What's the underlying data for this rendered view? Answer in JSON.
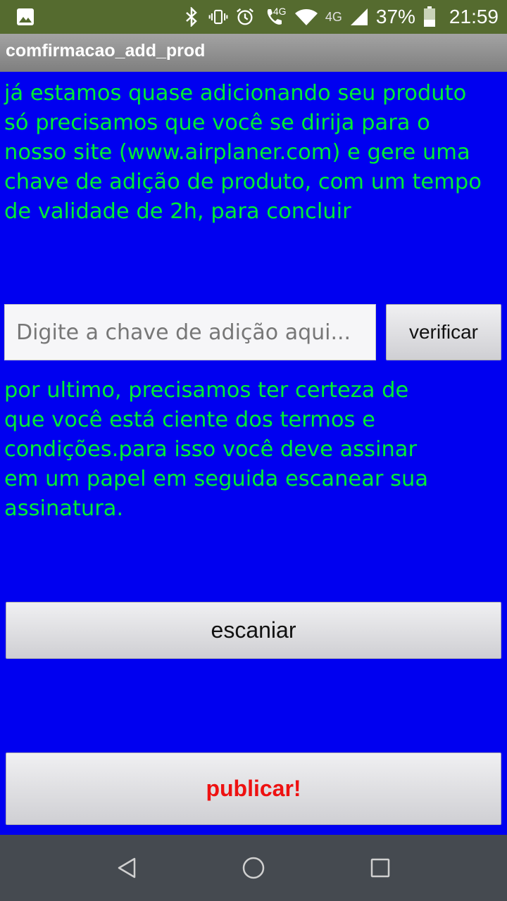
{
  "status_bar": {
    "network_label": "4G",
    "signal_label": "4G",
    "battery_percent": "37%",
    "time": "21:59",
    "icons": [
      "image-icon",
      "bluetooth-icon",
      "vibrate-icon",
      "alarm-icon",
      "volte-call-icon",
      "wifi-icon",
      "signal-icon",
      "battery-icon"
    ]
  },
  "action_bar": {
    "title": "comfirmacao_add_prod"
  },
  "main": {
    "intro_text": "já estamos quase adicionando seu produto\nsó precisamos que você se dirija para o\nnosso site (www.airplaner.com) e gere uma\nchave de adição de produto, com um tempo\nde validade de 2h, para concluir",
    "key_input": {
      "placeholder": "Digite a chave de adição aqui...",
      "value": ""
    },
    "verify_label": "verificar",
    "terms_text": "por ultimo, precisamos ter certeza de\nque você está ciente dos termos e\ncondições.para isso você deve assinar\nem um papel em seguida escanear sua\nassinatura.",
    "scan_label": "escaniar",
    "publish_label": "publicar!"
  },
  "nav_bar": {
    "icons": [
      "back-icon",
      "home-icon",
      "recents-icon"
    ]
  },
  "colors": {
    "background": "#0000f0",
    "text_green": "#00ee33",
    "publish_red": "#ee1111",
    "status_bar": "#556b2f"
  }
}
